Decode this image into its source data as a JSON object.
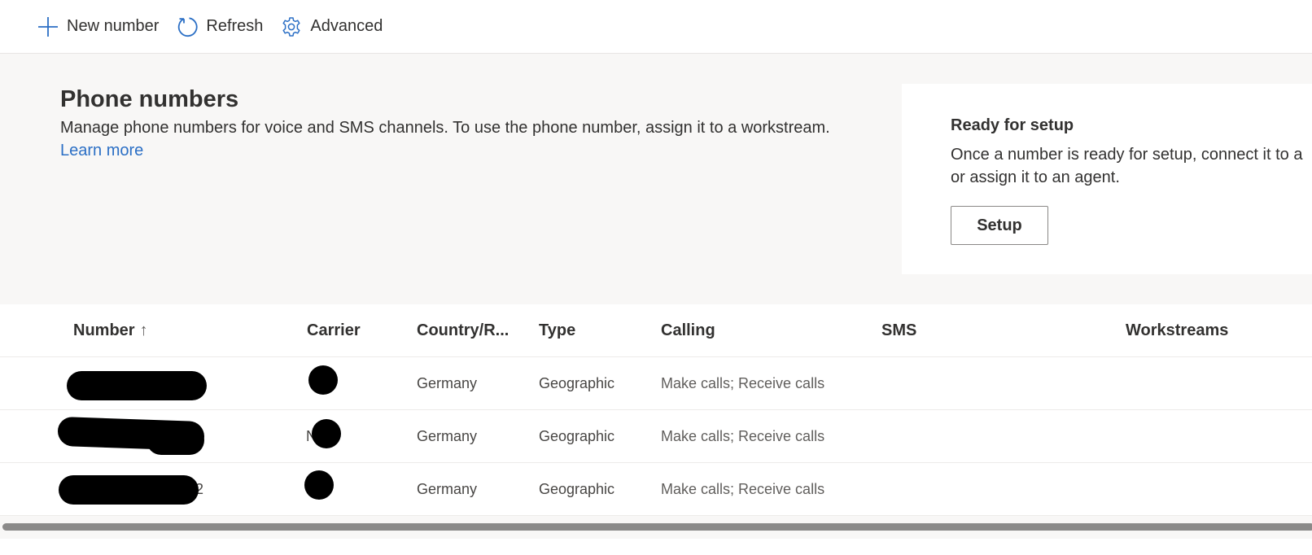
{
  "toolbar": {
    "new_number": {
      "label": "New number",
      "icon": "plus-icon"
    },
    "refresh": {
      "label": "Refresh",
      "icon": "refresh-icon"
    },
    "advanced": {
      "label": "Advanced",
      "icon": "gear-icon"
    }
  },
  "header": {
    "title": "Phone numbers",
    "description": "Manage phone numbers for voice and SMS channels. To use the phone number, assign it to a workstream.",
    "learn_more": "Learn more"
  },
  "setup_card": {
    "title": "Ready for setup",
    "description": "Once a number is ready for setup, connect it to a",
    "description_line2": "or assign it to an agent.",
    "button": "Setup"
  },
  "table": {
    "columns": [
      {
        "label": "Number",
        "sort": "ascending",
        "sort_glyph": "↑"
      },
      {
        "label": "Carrier"
      },
      {
        "label": "Country/R..."
      },
      {
        "label": "Type"
      },
      {
        "label": "Calling"
      },
      {
        "label": "SMS"
      },
      {
        "label": "Workstreams"
      }
    ],
    "rows": [
      {
        "number": "[redacted]",
        "number_peek": "",
        "carrier": "[redacted]",
        "carrier_peek": "",
        "country": "Germany",
        "type": "Geographic",
        "calling": "Make calls; Receive calls",
        "sms": "",
        "workstreams": ""
      },
      {
        "number": "[redacted]",
        "number_peek": "",
        "carrier": "[redacted]",
        "carrier_peek": "N",
        "country": "Germany",
        "type": "Geographic",
        "calling": "Make calls; Receive calls",
        "sms": "",
        "workstreams": ""
      },
      {
        "number": "[redacted]",
        "number_peek": "2",
        "carrier": "[redacted]",
        "carrier_peek": "",
        "country": "Germany",
        "type": "Geographic",
        "calling": "Make calls; Receive calls",
        "sms": "",
        "workstreams": ""
      }
    ]
  },
  "colors": {
    "accent": "#2b6fc5",
    "header_band": "#f8f7f6",
    "text": "#323130",
    "scrollbar_thumb": "#8b8a89"
  }
}
